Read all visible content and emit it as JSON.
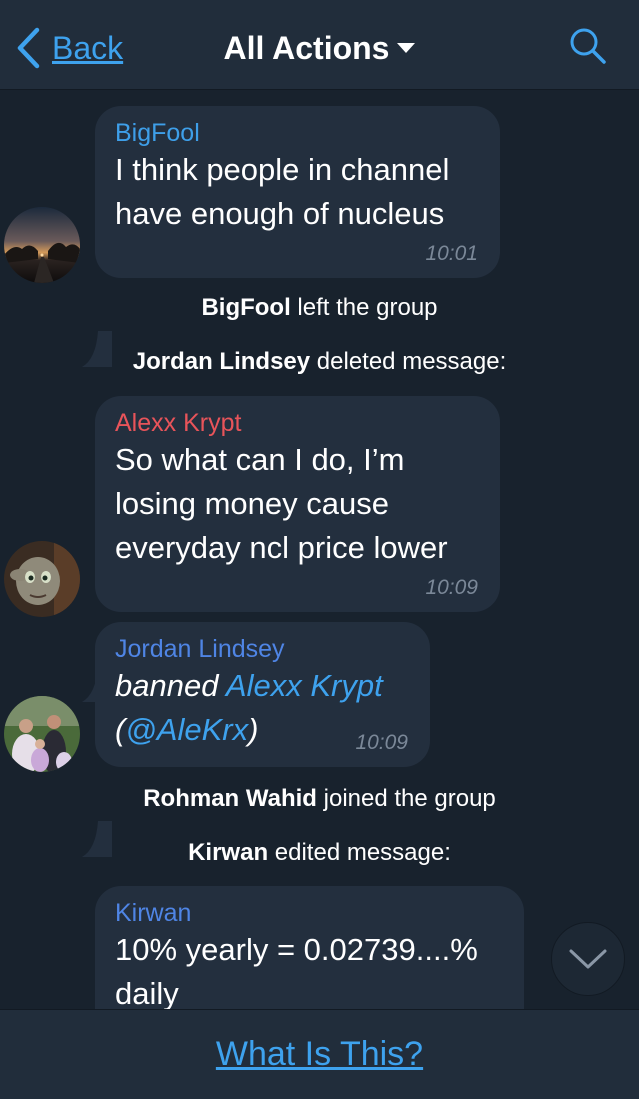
{
  "header": {
    "back_label": "Back",
    "title": "All Actions",
    "title_icon": "chevron-down-icon",
    "search_icon": "search-icon"
  },
  "colors": {
    "background": "#18222d",
    "bar": "#212d3b",
    "bubble": "#232f3e",
    "accent": "#3ea2ee",
    "name_bigfool": "#3e9fe9",
    "name_alexx": "#e8545a",
    "name_jordan": "#4f85e5",
    "name_kirwan": "#4f85e5",
    "timestamp": "#7b8898"
  },
  "messages": [
    {
      "sender": "BigFool",
      "line1": "I think people in channel",
      "line2": "have enough of nucleus",
      "time": "10:01"
    },
    {
      "sender": "Alexx Krypt",
      "line1": "So what can I do, I’m",
      "line2": "losing money cause",
      "line3": "everyday ncl price lower",
      "time": "10:09"
    },
    {
      "sender": "Jordan Lindsey",
      "action": "banned",
      "target": "Alexx Krypt",
      "paren_open": "(",
      "handle": "@AleKrx",
      "paren_close": ")",
      "time": "10:09"
    },
    {
      "sender": "Kirwan",
      "line1": "10% yearly = 0.02739....%",
      "line2": "daily"
    }
  ],
  "events": [
    {
      "name": "BigFool",
      "text": " left the group"
    },
    {
      "name": "Jordan Lindsey",
      "text": " deleted message:"
    },
    {
      "name": "Rohman Wahid",
      "text": " joined the group"
    },
    {
      "name": "Kirwan",
      "text": " edited message:"
    }
  ],
  "scroll_icon": "chevron-down-icon",
  "footer": {
    "link": "What Is This?"
  }
}
